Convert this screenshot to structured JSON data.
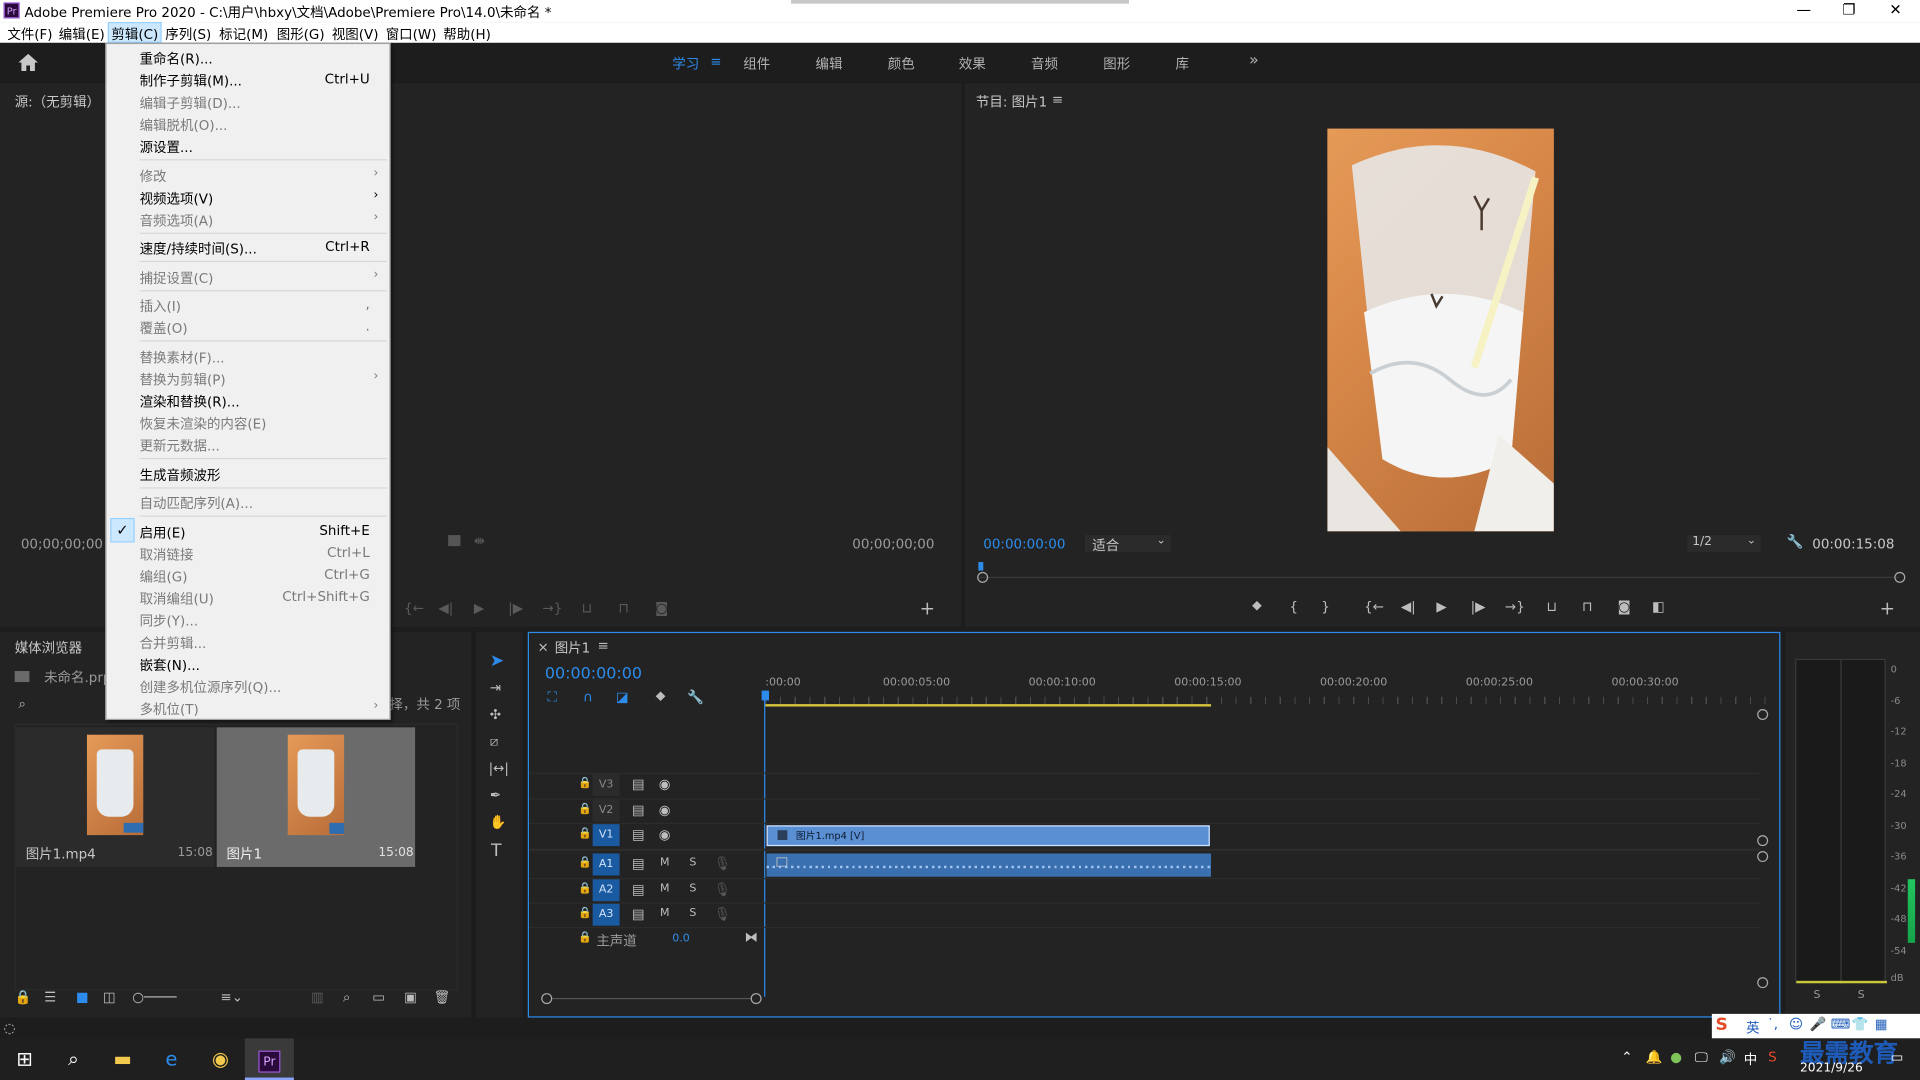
{
  "window": {
    "title": "Adobe Premiere Pro 2020 - C:\\用户\\hbxy\\文档\\Adobe\\Premiere Pro\\14.0\\未命名 *",
    "app_icon": "Pr",
    "minimize": "—",
    "restore": "❐",
    "close": "✕"
  },
  "menubar": {
    "items": [
      {
        "label": "文件(F)"
      },
      {
        "label": "编辑(E)"
      },
      {
        "label": "剪辑(C)"
      },
      {
        "label": "序列(S)"
      },
      {
        "label": "标记(M)"
      },
      {
        "label": "图形(G)"
      },
      {
        "label": "视图(V)"
      },
      {
        "label": "窗口(W)"
      },
      {
        "label": "帮助(H)"
      }
    ]
  },
  "workspaces": {
    "tabs": [
      {
        "label": "学习"
      },
      {
        "label": "组件"
      },
      {
        "label": "编辑"
      },
      {
        "label": "颜色"
      },
      {
        "label": "效果"
      },
      {
        "label": "音频"
      },
      {
        "label": "图形"
      },
      {
        "label": "库"
      }
    ],
    "more": "»",
    "active_menu_glyph": "≡"
  },
  "clip_menu": {
    "items": [
      {
        "label": "重命名(R)...",
        "shortcut": "",
        "enabled": true
      },
      {
        "label": "制作子剪辑(M)...",
        "shortcut": "Ctrl+U",
        "enabled": true
      },
      {
        "label": "编辑子剪辑(D)...",
        "shortcut": "",
        "enabled": false
      },
      {
        "label": "编辑脱机(O)...",
        "shortcut": "",
        "enabled": false
      },
      {
        "label": "源设置...",
        "shortcut": "",
        "enabled": true
      },
      {
        "label": "修改",
        "shortcut": "",
        "enabled": false
      },
      {
        "label": "视频选项(V)",
        "shortcut": "",
        "enabled": true
      },
      {
        "label": "音频选项(A)",
        "shortcut": "",
        "enabled": false
      },
      {
        "label": "速度/持续时间(S)...",
        "shortcut": "Ctrl+R",
        "enabled": true
      },
      {
        "label": "捕捉设置(C)",
        "shortcut": "",
        "enabled": false
      },
      {
        "label": "插入(I)",
        "shortcut": ",",
        "enabled": false
      },
      {
        "label": "覆盖(O)",
        "shortcut": ".",
        "enabled": false
      },
      {
        "label": "替换素材(F)...",
        "shortcut": "",
        "enabled": false
      },
      {
        "label": "替换为剪辑(P)",
        "shortcut": "",
        "enabled": false
      },
      {
        "label": "渲染和替换(R)...",
        "shortcut": "",
        "enabled": true
      },
      {
        "label": "恢复未渲染的内容(E)",
        "shortcut": "",
        "enabled": false
      },
      {
        "label": "更新元数据...",
        "shortcut": "",
        "enabled": false
      },
      {
        "label": "生成音频波形",
        "shortcut": "",
        "enabled": true
      },
      {
        "label": "自动匹配序列(A)...",
        "shortcut": "",
        "enabled": false
      },
      {
        "label": "启用(E)",
        "shortcut": "Shift+E",
        "enabled": true,
        "checked": true
      },
      {
        "label": "取消链接",
        "shortcut": "Ctrl+L",
        "enabled": false
      },
      {
        "label": "编组(G)",
        "shortcut": "Ctrl+G",
        "enabled": false
      },
      {
        "label": "取消编组(U)",
        "shortcut": "Ctrl+Shift+G",
        "enabled": false
      },
      {
        "label": "同步(Y)...",
        "shortcut": "",
        "enabled": false
      },
      {
        "label": "合并剪辑...",
        "shortcut": "",
        "enabled": false
      },
      {
        "label": "嵌套(N)...",
        "shortcut": "",
        "enabled": true
      },
      {
        "label": "创建多机位源序列(Q)...",
        "shortcut": "",
        "enabled": false
      },
      {
        "label": "多机位(T)",
        "shortcut": "",
        "enabled": false
      }
    ],
    "checkmark": "✓",
    "submenu_arrow": "›"
  },
  "source_monitor": {
    "title": "源:（无剪辑）",
    "timecode_left": "00;00;00;00",
    "timecode_right": "00;00;00;00"
  },
  "program_monitor": {
    "title": "节目: 图片1",
    "timecode": "00:00:00:00",
    "fit": "适合",
    "resolution": "1/2",
    "duration": "00:00:15:08"
  },
  "project_panel": {
    "title": "媒体浏览器",
    "project_name": "未命名.prpr",
    "selection_info": "择，共 2 项",
    "items": [
      {
        "name": "图片1.mp4",
        "duration": "15:08"
      },
      {
        "name": "图片1",
        "duration": "15:08"
      }
    ]
  },
  "timeline": {
    "tab_close": "×",
    "sequence_name": "图片1",
    "timecode": "00:00:00:00",
    "ruler": [
      ":00:00",
      "00:00:05:00",
      "00:00:10:00",
      "00:00:15:00",
      "00:00:20:00",
      "00:00:25:00",
      "00:00:30:00"
    ],
    "video_tracks": [
      "V3",
      "V2",
      "V1"
    ],
    "audio_tracks": [
      "A1",
      "A2",
      "A3"
    ],
    "mute_label": "M",
    "solo_label": "S",
    "master": {
      "label": "主声道",
      "value": "0.0"
    },
    "video_clip": "图片1.mp4 [V]"
  },
  "audio_meter": {
    "scale": [
      "0",
      "-6",
      "-12",
      "-18",
      "-24",
      "-30",
      "-36",
      "-42",
      "-48",
      "-54",
      "dB"
    ],
    "solo_left": "S",
    "solo_right": "S"
  },
  "taskbar": {
    "date": "2021/9/26",
    "ime": "英",
    "watermark": "最需教育"
  },
  "colors": {
    "accent": "#2d8ceb",
    "panel": "#232323",
    "background": "#1d1d1d",
    "clip_video": "#5b8fd4",
    "clip_audio": "#3a6fb0"
  }
}
